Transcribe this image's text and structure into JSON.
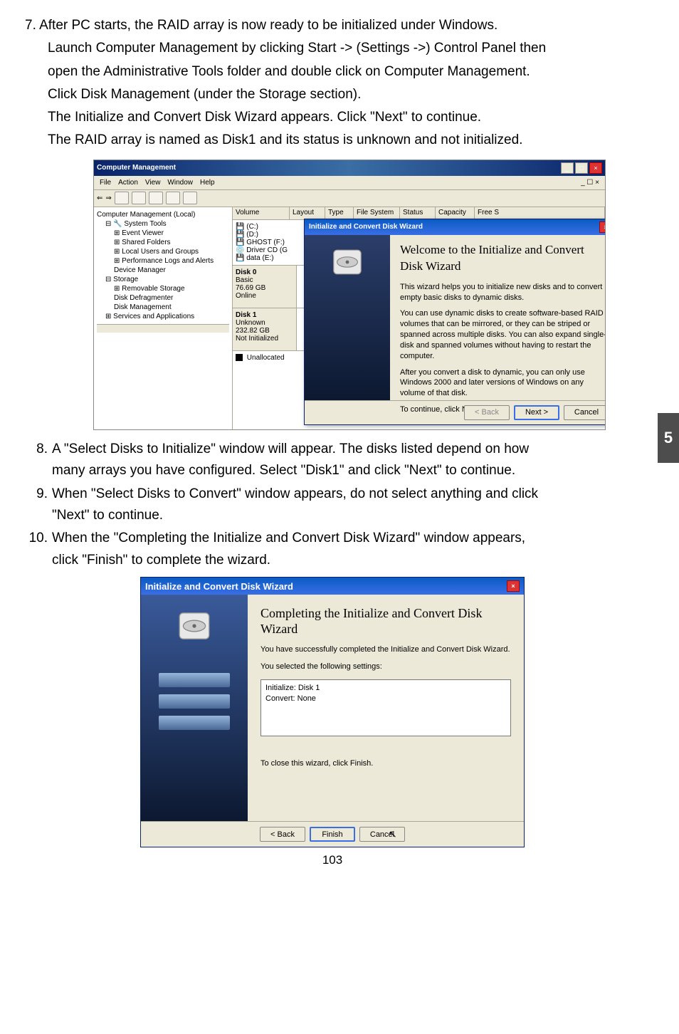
{
  "sidetab": "5",
  "step7": {
    "num": "7.",
    "line1": "After PC starts, the RAID array is now ready to be initialized under Windows.",
    "line2": "Launch Computer Management by clicking Start -> (Settings ->) Control Panel then",
    "line3": "open the Administrative Tools folder and double click on Computer Management.",
    "line4": "Click Disk Management (under the Storage section).",
    "line5": "The Initialize and Convert Disk Wizard appears. Click \"Next\" to continue.",
    "line6": "The RAID array is named as Disk1 and its status is unknown and not initialized."
  },
  "shot1": {
    "title": "Computer Management",
    "menu": {
      "file": "File",
      "action": "Action",
      "view": "View",
      "window": "Window",
      "help": "Help"
    },
    "tree": {
      "root": "Computer Management (Local)",
      "systools": "System Tools",
      "event": "Event Viewer",
      "shared": "Shared Folders",
      "users": "Local Users and Groups",
      "perf": "Performance Logs and Alerts",
      "devmgr": "Device Manager",
      "storage": "Storage",
      "remov": "Removable Storage",
      "defrag": "Disk Defragmenter",
      "diskmgmt": "Disk Management",
      "services": "Services and Applications"
    },
    "cols": {
      "volume": "Volume",
      "layout": "Layout",
      "type": "Type",
      "fs": "File System",
      "status": "Status",
      "cap": "Capacity",
      "free": "Free S"
    },
    "vols": {
      "c": "(C:)",
      "d": "(D:)",
      "ghost": "GHOST (F:)",
      "driver": "Driver CD (G",
      "data": "data (E:)"
    },
    "d0": {
      "name": "Disk 0",
      "type": "Basic",
      "size": "76.69 GB",
      "status": "Online"
    },
    "d1": {
      "name": "Disk 1",
      "type": "Unknown",
      "size": "232.82 GB",
      "status": "Not Initialized"
    },
    "unalloc": "Unallocated"
  },
  "wiz1": {
    "title": "Initialize and Convert Disk Wizard",
    "heading": "Welcome to the Initialize and Convert Disk Wizard",
    "p1": "This wizard helps you to initialize new disks and to convert empty basic disks to dynamic disks.",
    "p2": "You can use dynamic disks to create software-based RAID volumes that can be mirrored, or they can be striped or spanned across multiple disks. You can also expand single-disk and spanned volumes without having to restart the computer.",
    "p3": "After you convert a disk to dynamic, you can only use Windows 2000 and later versions of Windows on any volume of that disk.",
    "p4": "To continue, click Next.",
    "back": "< Back",
    "next": "Next >",
    "cancel": "Cancel"
  },
  "step8": {
    "num": "8.",
    "l1": "A \"Select Disks to Initialize\" window will appear. The disks listed depend on how",
    "l2": "many arrays you have configured. Select \"Disk1\" and click \"Next\" to continue."
  },
  "step9": {
    "num": "9.",
    "l1": "When \"Select Disks to Convert\" window appears, do not select anything and click",
    "l2": "\"Next\" to continue."
  },
  "step10": {
    "num": "10.",
    "l1": "When the \"Completing the Initialize and Convert Disk Wizard\" window appears,",
    "l2": "click \"Finish\" to complete the wizard."
  },
  "shot2": {
    "title": "Initialize and Convert Disk Wizard",
    "heading": "Completing the Initialize and Convert Disk Wizard",
    "p1": "You have successfully completed the Initialize and Convert Disk Wizard.",
    "p2": "You selected the following settings:",
    "box1": "Initialize: Disk 1",
    "box2": "Convert: None",
    "p3": "To close this wizard, click Finish.",
    "back": "< Back",
    "finish": "Finish",
    "cancel": "Cancel"
  },
  "pagenum": "103"
}
